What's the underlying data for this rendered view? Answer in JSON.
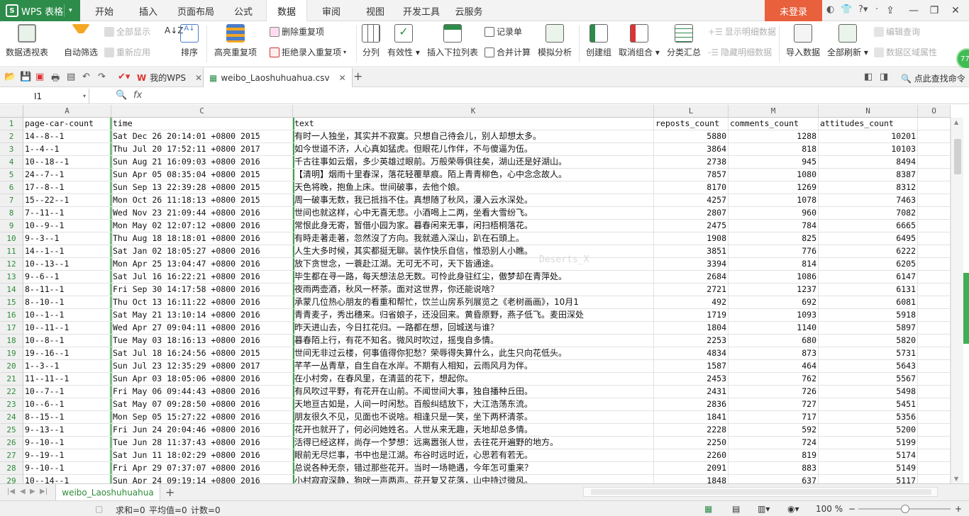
{
  "title_bar": {
    "app_name": "WPS 表格",
    "menus": [
      "开始",
      "插入",
      "页面布局",
      "公式",
      "数据",
      "审阅",
      "视图",
      "开发工具",
      "云服务"
    ],
    "active_menu": "数据",
    "login": "未登录"
  },
  "ribbon": {
    "pivot": "数据透视表",
    "autofilter": "自动筛选",
    "show_all": "全部显示",
    "reapply": "重新应用",
    "sort": "排序",
    "highlight_dup": "高亮重复项",
    "remove_dup": "删除重复项",
    "reject_dup": "拒绝录入重复项",
    "split": "分列",
    "validity": "有效性",
    "insert_dropdown": "插入下拉列表",
    "record_form": "记录单",
    "consolidate": "合并计算",
    "what_if": "模拟分析",
    "create_group": "创建组",
    "ungroup": "取消组合",
    "subtotal": "分类汇总",
    "show_detail": "显示明细数据",
    "hide_detail": "隐藏明细数据",
    "import_data": "导入数据",
    "refresh_all": "全部刷新",
    "edit_query": "编辑查询",
    "range_props": "数据区域属性",
    "badge": "77"
  },
  "tabs": {
    "home_tab": "我的WPS",
    "file_tab": "weibo_Laoshuhuahua.csv",
    "find": "点此查找命令"
  },
  "formula_bar": {
    "cell_ref": "I1",
    "fx": "fx",
    "value": ""
  },
  "sheet": {
    "columns": [
      "A",
      "C",
      "K",
      "L",
      "M",
      "N",
      "O"
    ],
    "row_numbers": [
      1,
      2,
      3,
      4,
      5,
      6,
      7,
      8,
      9,
      10,
      11,
      12,
      13,
      14,
      15,
      16,
      17,
      18,
      19,
      20,
      21,
      22,
      23,
      24,
      25,
      26,
      27,
      28,
      29
    ],
    "rows": [
      [
        "page-car-count",
        "time",
        "text",
        "reposts_count",
        "comments_count",
        "attitudes_count"
      ],
      [
        "14--8--1",
        "Sat Dec 26 20:14:01 +0800 2015",
        "有时一人独坐，其实并不寂寞。只想自己待会儿，别人却想太多。",
        "5880",
        "1288",
        "10201"
      ],
      [
        "1--4--1",
        "Thu Jul 20 17:52:11 +0800 2017",
        "如今世道不济，人心真如猛虎。但眼花儿作伴，不与傻逼为伍。",
        "3864",
        "818",
        "10103"
      ],
      [
        "10--18--1",
        "Sun Aug 21 16:09:03 +0800 2016",
        "千古往事如云烟，多少英雄过眼前。万般荣辱俱往矣，湖山还是好湖山。",
        "2738",
        "945",
        "8494"
      ],
      [
        "24--7--1",
        "Sun Apr 05 08:35:04 +0800 2015",
        "【清明】烟雨十里春深，落花轻覆草痕。陌上青青柳色，心中念念故人。",
        "7857",
        "1080",
        "8387"
      ],
      [
        "17--8--1",
        "Sun Sep 13 22:39:28 +0800 2015",
        "天色将晚，抱鱼上床。世间破事，去他个娘。",
        "8170",
        "1269",
        "8312"
      ],
      [
        "15--22--1",
        "Mon Oct 26 11:18:13 +0800 2015",
        "周一破事无数，我已抵挡不住。真想随了秋风，漫入云水深处。",
        "4257",
        "1078",
        "7463"
      ],
      [
        "7--11--1",
        "Wed Nov 23 21:09:44 +0800 2016",
        "世间也就这样，心中无喜无悲。小酒喝上二两，坐看大雪纷飞。",
        "2807",
        "960",
        "7082"
      ],
      [
        "10--9--1",
        "Mon May 02 12:07:12 +0800 2016",
        "常恨此身无寄，暂借小园为家。暮春闲来无事，闲扫梧桐落花。",
        "2475",
        "784",
        "6665"
      ],
      [
        "9--3--1",
        "Thu Aug 18 18:18:01 +0800 2016",
        "有時走著走著，忽然沒了方向。我就遁入深山，趴在石頭上。",
        "1908",
        "825",
        "6495"
      ],
      [
        "14--1--1",
        "Sat Jan 02 18:05:27 +0800 2016",
        "人生大多时候，其实都挺无聊。装作快乐自信，惟恐别人小瞧。",
        "3851",
        "776",
        "6222"
      ],
      [
        "10--13--1",
        "Mon Apr 25 13:04:47 +0800 2016",
        "放下贪世念，一蓑赴江湖。无可无不可，天下皆通途。",
        "3394",
        "814",
        "6205"
      ],
      [
        "9--6--1",
        "Sat Jul 16 16:22:21 +0800 2016",
        "毕生都在寻一路，每天想法总无数。可怜此身驻红尘，傲梦却在青萍处。",
        "2684",
        "1086",
        "6147"
      ],
      [
        "8--11--1",
        "Fri Sep 30 14:17:58 +0800 2016",
        "夜雨两壶酒，秋风一杯茶。面对这世界，你还能说啥？",
        "2721",
        "1237",
        "6131"
      ],
      [
        "8--10--1",
        "Thu Oct 13 16:11:22 +0800 2016",
        "承蒙几位热心朋友的看重和帮忙，饮兰山房系列展览之《老树画画》，10月1",
        "492",
        "692",
        "6081"
      ],
      [
        "10--1--1",
        "Sat May 21 13:10:14 +0800 2016",
        "青青麦子，秀出穗来。归省娘子，还没回来。黄昏原野，燕子低飞。麦田深处",
        "1719",
        "1093",
        "5918"
      ],
      [
        "10--11--1",
        "Wed Apr 27 09:04:11 +0800 2016",
        "昨天进山去，今日扛花归。一路都在想，回城送与谁？",
        "1804",
        "1140",
        "5897"
      ],
      [
        "10--8--1",
        "Tue May 03 18:16:13 +0800 2016",
        "暮春陌上行，有花不知名。微风时吹过，摇曳自多情。",
        "2253",
        "680",
        "5820"
      ],
      [
        "19--16--1",
        "Sat Jul 18 16:24:56 +0800 2015",
        "世间无非过云楼，何事值得你犯愁？荣辱得失算什么，此生只向花低头。",
        "4834",
        "873",
        "5731"
      ],
      [
        "1--3--1",
        "Sun Jul 23 12:35:29 +0800 2017",
        "芊芊一丛青草，自生自在水岸。不期有人相知，云雨风月为伴。",
        "1587",
        "464",
        "5643"
      ],
      [
        "11--11--1",
        "Sun Apr 03 18:05:06 +0800 2016",
        "在小村旁，在春风里，在清蓝的花下，想起你。",
        "2453",
        "762",
        "5567"
      ],
      [
        "10--7--1",
        "Fri May 06 09:44:43 +0800 2016",
        "有风吹过平野，有花开在山前。不闻世间大事，独自播种丘田。",
        "2431",
        "726",
        "5498"
      ],
      [
        "10--6--1",
        "Sat May 07 09:28:50 +0800 2016",
        "天地亘古如是，人间一时闲愁。百般纠结放下，大江浩荡东流。",
        "2836",
        "727",
        "5451"
      ],
      [
        "8--15--1",
        "Mon Sep 05 15:27:22 +0800 2016",
        "朋友很久不见，见面也不说啥。相逢只是一笑，坐下两杯清茶。",
        "1841",
        "717",
        "5356"
      ],
      [
        "9--13--1",
        "Fri Jun 24 20:04:46 +0800 2016",
        "花开也就开了，何必问她姓名。人世从来无趣，天地却总多情。",
        "2228",
        "592",
        "5200"
      ],
      [
        "9--10--1",
        "Tue Jun 28 11:37:43 +0800 2016",
        "活得已经这样，尚存一个梦想：远离嚣张人世，去往花开遍野的地方。",
        "2250",
        "724",
        "5199"
      ],
      [
        "9--19--1",
        "Sat Jun 11 18:02:29 +0800 2016",
        "眼前无尽烂事，书中也是江湖。布谷时远时近，心思若有若无。",
        "2260",
        "819",
        "5174"
      ],
      [
        "9--10--1",
        "Fri Apr 29 07:37:07 +0800 2016",
        "总说各种无奈，错过那些花开。当时一场艳遇，今年怎可重来？",
        "2091",
        "883",
        "5149"
      ],
      [
        "10--14--1",
        "Sun Apr 24 09:19:14 +0800 2016",
        "小村寂寂深静，狗吠一声两声。花开复又花落，山中持过微风。",
        "1848",
        "637",
        "5117"
      ]
    ],
    "watermark": "Deserts_X"
  },
  "sheet_tabs": {
    "sheet_name": "weibo_Laoshuhuahua"
  },
  "status_bar": {
    "sum": "求和=0",
    "avg": "平均值=0",
    "count": "计数=0",
    "zoom": "100 %"
  },
  "colors": {
    "brand_green": "#2d8c4a",
    "login_orange": "#e8603c",
    "row_number_green": "#2e8b3a"
  }
}
